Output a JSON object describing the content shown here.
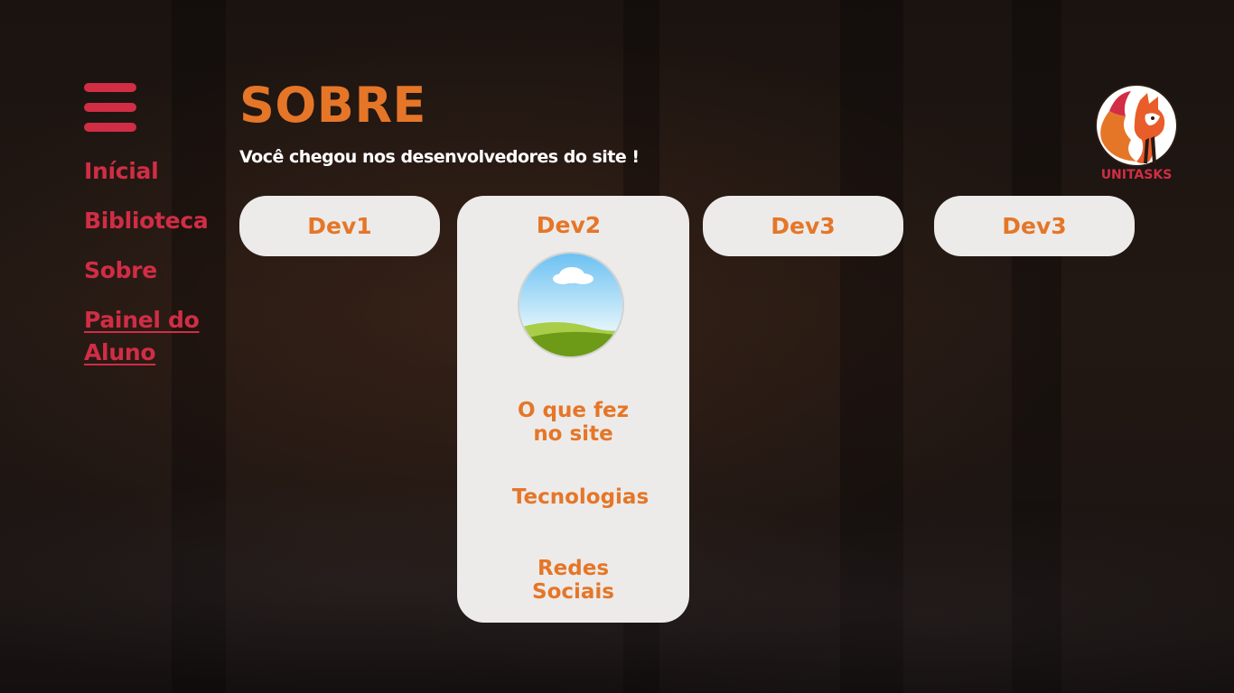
{
  "colors": {
    "accent_orange": "#e57628",
    "accent_red": "#d12d45",
    "card_bg": "#ecebea",
    "page_bg": "#1d1410"
  },
  "menu_icon": "hamburger-icon",
  "nav": {
    "items": [
      {
        "label": "Inícial"
      },
      {
        "label": "Biblioteca"
      },
      {
        "label": "Sobre"
      },
      {
        "label": "Painel do Aluno"
      }
    ]
  },
  "header": {
    "title": "SOBRE",
    "subtitle": "Você chegou nos desenvolvedores do site !"
  },
  "logo": {
    "text": "UNITASKS",
    "icon": "fox-logo-icon"
  },
  "devs": [
    {
      "label": "Dev1"
    },
    {
      "label": "Dev2"
    },
    {
      "label": "Dev3"
    },
    {
      "label": "Dev3"
    }
  ],
  "card": {
    "title": "Dev2",
    "avatar_icon": "profile-picture-placeholder",
    "items": [
      {
        "line1": "O que fez",
        "line2": "no site"
      },
      {
        "line1": "Tecnologias",
        "line2": ""
      },
      {
        "line1": "Redes",
        "line2": "Sociais"
      }
    ]
  }
}
